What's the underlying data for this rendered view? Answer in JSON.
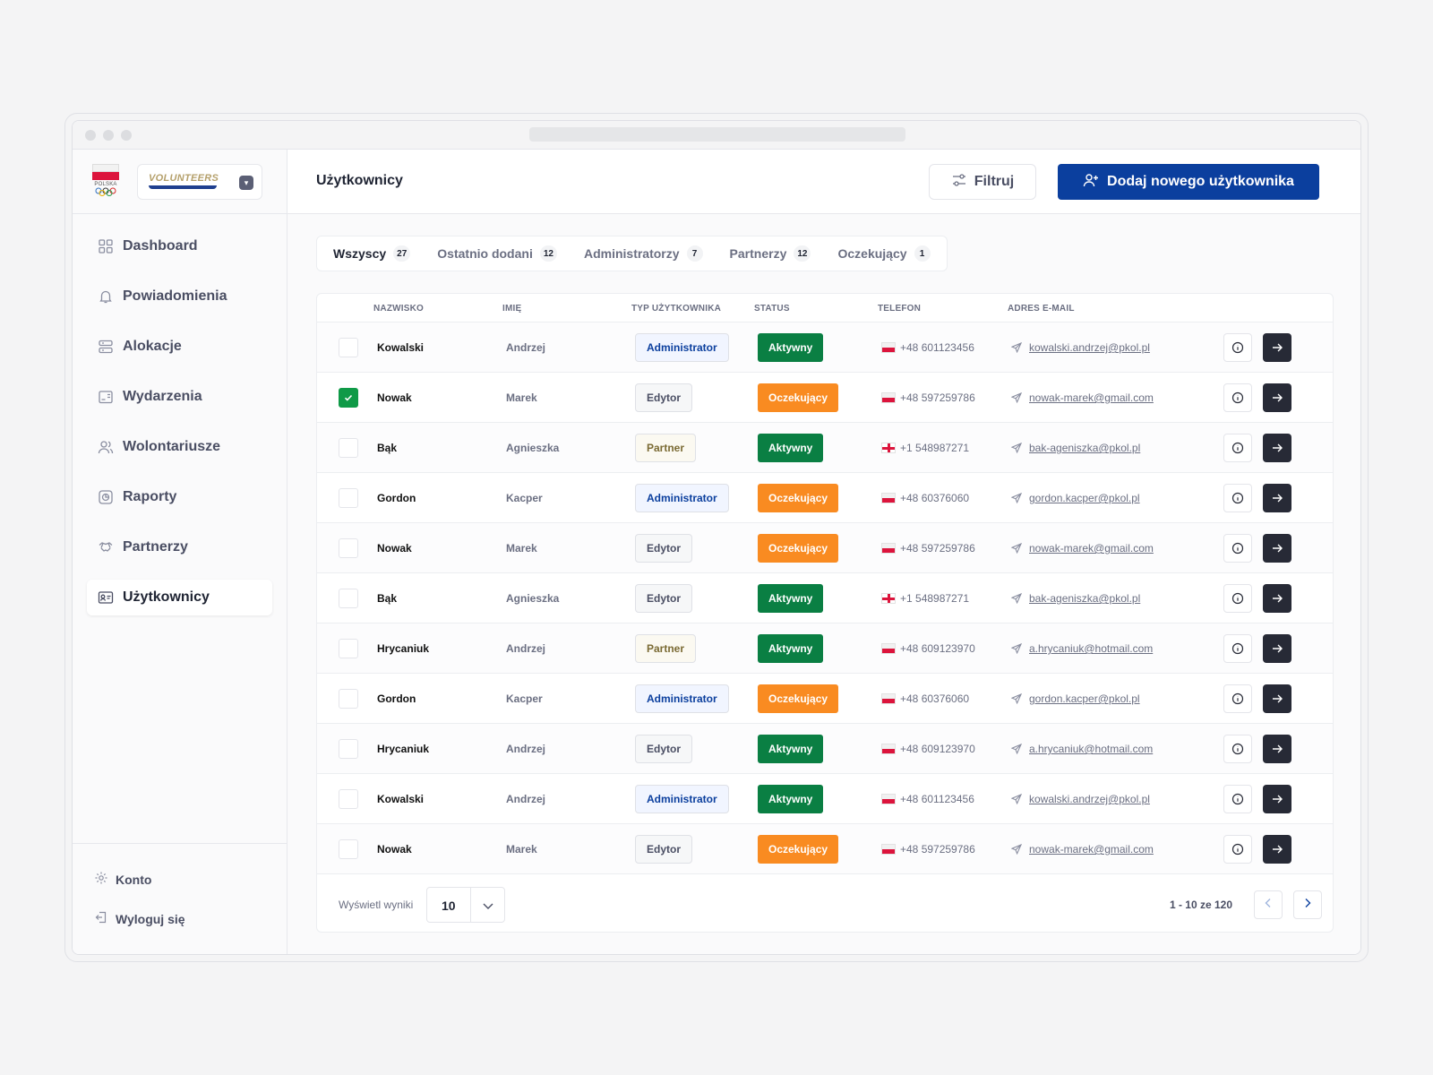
{
  "brand": {
    "logo_text": "POLSKA",
    "org_name": "VOLUNTEERS"
  },
  "sidebar": {
    "items": [
      {
        "label": "Dashboard",
        "icon": "grid-icon"
      },
      {
        "label": "Powiadomienia",
        "icon": "bell-icon"
      },
      {
        "label": "Alokacje",
        "icon": "server-icon"
      },
      {
        "label": "Wydarzenia",
        "icon": "calendar-icon"
      },
      {
        "label": "Wolontariusze",
        "icon": "users-icon"
      },
      {
        "label": "Raporty",
        "icon": "report-icon"
      },
      {
        "label": "Partnerzy",
        "icon": "handshake-icon"
      },
      {
        "label": "Użytkownicy",
        "icon": "id-card-icon",
        "active": true
      }
    ],
    "account_label": "Konto",
    "logout_label": "Wyloguj się"
  },
  "header": {
    "title": "Użytkownicy",
    "filter_label": "Filtruj",
    "add_label": "Dodaj nowego użytkownika"
  },
  "tabs": [
    {
      "label": "Wszyscy",
      "count": "27",
      "active": true
    },
    {
      "label": "Ostatnio dodani",
      "count": "12"
    },
    {
      "label": "Administratorzy",
      "count": "7"
    },
    {
      "label": "Partnerzy",
      "count": "12"
    },
    {
      "label": "Oczekujący",
      "count": "1"
    }
  ],
  "table": {
    "columns": [
      "NAZWISKO",
      "IMIĘ",
      "TYP UŻYTKOWNIKA",
      "STATUS",
      "TELEFON",
      "ADRES E-MAIL"
    ],
    "rows": [
      {
        "checked": false,
        "last": "Kowalski",
        "first": "Andrzej",
        "type": "Administrator",
        "status": "Aktywny",
        "flag": "pl",
        "phone": "+48 601123456",
        "email": "kowalski.andrzej@pkol.pl"
      },
      {
        "checked": true,
        "last": "Nowak",
        "first": "Marek",
        "type": "Edytor",
        "status": "Oczekujący",
        "flag": "pl",
        "phone": "+48 597259786",
        "email": "nowak-marek@gmail.com"
      },
      {
        "checked": false,
        "last": "Bąk",
        "first": "Agnieszka",
        "type": "Partner",
        "status": "Aktywny",
        "flag": "gb",
        "phone": "+1 548987271",
        "email": "bak-ageniszka@pkol.pl"
      },
      {
        "checked": false,
        "last": "Gordon",
        "first": "Kacper",
        "type": "Administrator",
        "status": "Oczekujący",
        "flag": "pl",
        "phone": "+48 60376060",
        "email": "gordon.kacper@pkol.pl"
      },
      {
        "checked": false,
        "last": "Nowak",
        "first": "Marek",
        "type": "Edytor",
        "status": "Oczekujący",
        "flag": "pl",
        "phone": "+48 597259786",
        "email": "nowak-marek@gmail.com"
      },
      {
        "checked": false,
        "last": "Bąk",
        "first": "Agnieszka",
        "type": "Edytor",
        "status": "Aktywny",
        "flag": "gb",
        "phone": "+1 548987271",
        "email": "bak-ageniszka@pkol.pl"
      },
      {
        "checked": false,
        "last": "Hrycaniuk",
        "first": "Andrzej",
        "type": "Partner",
        "status": "Aktywny",
        "flag": "pl",
        "phone": "+48 609123970",
        "email": "a.hrycaniuk@hotmail.com"
      },
      {
        "checked": false,
        "last": "Gordon",
        "first": "Kacper",
        "type": "Administrator",
        "status": "Oczekujący",
        "flag": "pl",
        "phone": "+48 60376060",
        "email": "gordon.kacper@pkol.pl"
      },
      {
        "checked": false,
        "last": "Hrycaniuk",
        "first": "Andrzej",
        "type": "Edytor",
        "status": "Aktywny",
        "flag": "pl",
        "phone": "+48 609123970",
        "email": "a.hrycaniuk@hotmail.com"
      },
      {
        "checked": false,
        "last": "Kowalski",
        "first": "Andrzej",
        "type": "Administrator",
        "status": "Aktywny",
        "flag": "pl",
        "phone": "+48 601123456",
        "email": "kowalski.andrzej@pkol.pl"
      },
      {
        "checked": false,
        "last": "Nowak",
        "first": "Marek",
        "type": "Edytor",
        "status": "Oczekujący",
        "flag": "pl",
        "phone": "+48 597259786",
        "email": "nowak-marek@gmail.com"
      }
    ]
  },
  "footer": {
    "per_page_label": "Wyświetl wyniki",
    "per_page_value": "10",
    "range_text": "1 - 10 ze 120"
  },
  "colors": {
    "primary": "#0b3f9e",
    "active_status": "#0a7f43",
    "pending_status": "#f98b21",
    "checkbox_checked": "#0f9a47",
    "admin_text": "#0b3f9e",
    "admin_bg": "#f1f5ff",
    "partner_text": "#7a6a33",
    "partner_bg": "#fbf9f1",
    "editor_text": "#4a4e63",
    "editor_bg": "#f6f7f8"
  }
}
